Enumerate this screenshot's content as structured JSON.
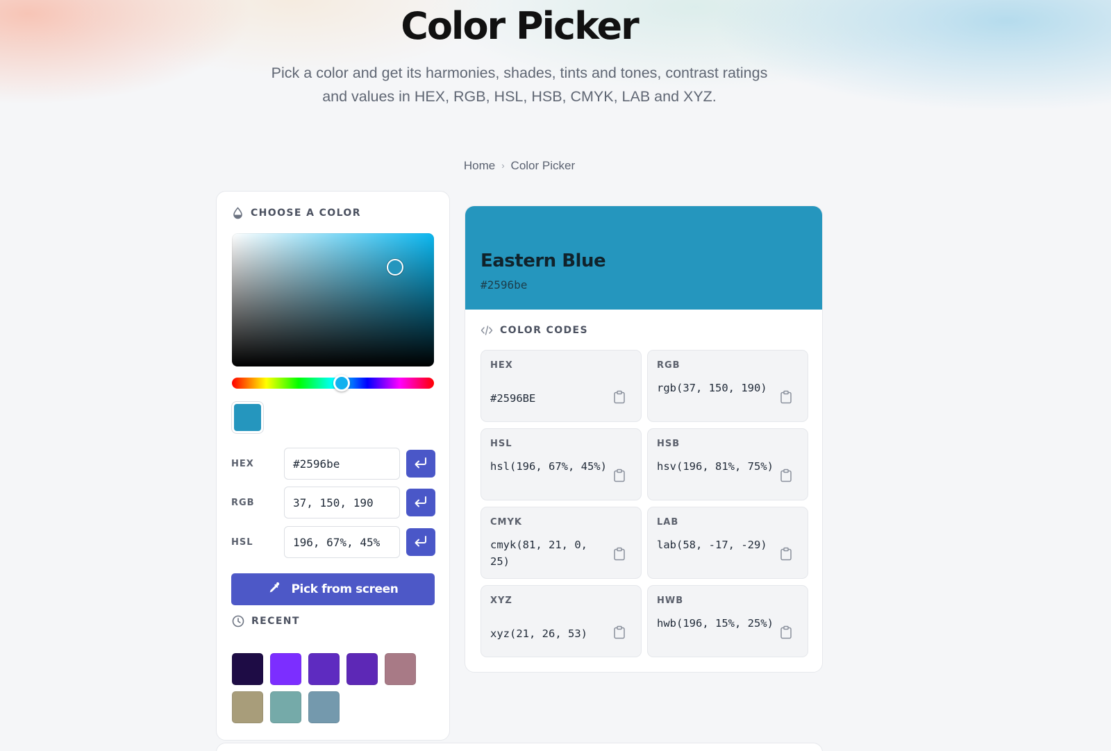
{
  "header": {
    "title": "Color Picker",
    "subtitle": "Pick a color and get its harmonies, shades, tints and tones, contrast ratings and values in HEX, RGB, HSL, HSB, CMYK, LAB and XYZ."
  },
  "breadcrumb": {
    "home": "Home",
    "separator": "›",
    "current": "Color Picker"
  },
  "picker": {
    "heading": "CHOOSE A COLOR",
    "current_color": "#2596be",
    "hue_color": "#0bb7f0",
    "fields": [
      {
        "label": "HEX",
        "value": "#2596be"
      },
      {
        "label": "RGB",
        "value": "37, 150, 190"
      },
      {
        "label": "HSL",
        "value": "196, 67%, 45%"
      }
    ],
    "pick_button": "Pick from screen",
    "recent_heading": "RECENT",
    "recent_colors": [
      "#1e0c45",
      "#7c2eff",
      "#5e2bc0",
      "#5d28b6",
      "#a87a86",
      "#a89d7a",
      "#75aaa9",
      "#7499ad"
    ]
  },
  "color_info": {
    "name": "Eastern Blue",
    "hex": "#2596be",
    "codes_heading": "COLOR CODES",
    "codes": [
      {
        "label": "HEX",
        "value": "#2596BE"
      },
      {
        "label": "RGB",
        "value": "rgb(37, 150, 190)"
      },
      {
        "label": "HSL",
        "value": "hsl(196, 67%, 45%)"
      },
      {
        "label": "HSB",
        "value": "hsv(196, 81%, 75%)"
      },
      {
        "label": "CMYK",
        "value": "cmyk(81, 21, 0, 25)"
      },
      {
        "label": "LAB",
        "value": "lab(58, -17, -29)"
      },
      {
        "label": "XYZ",
        "value": "xyz(21, 26, 53)"
      },
      {
        "label": "HWB",
        "value": "hwb(196, 15%, 25%)"
      }
    ]
  },
  "colors": {
    "accent": "#4a57c8",
    "page_background": "#f5f6f8",
    "tile_background": "#f3f4f6"
  }
}
